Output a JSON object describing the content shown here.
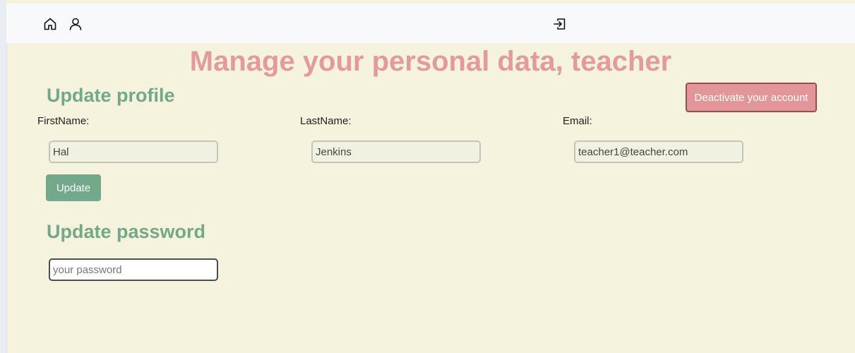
{
  "nav": {
    "icons": [
      "home-icon",
      "user-icon",
      "login-icon"
    ]
  },
  "page": {
    "title": "Manage your personal data, teacher"
  },
  "profile": {
    "heading": "Update profile",
    "deactivate_label": "Deactivate your account",
    "first_name_label": "FirstName:",
    "first_name_value": "Hal",
    "last_name_label": "LastName:",
    "last_name_value": "Jenkins",
    "email_label": "Email:",
    "email_value": "teacher1@teacher.com",
    "update_label": "Update"
  },
  "password": {
    "heading": "Update password",
    "placeholder": "your password"
  },
  "colors": {
    "background": "#f5f3dd",
    "navbar": "#f8f9fa",
    "title": "#e39a9a",
    "accent_green": "#73a88a",
    "danger": "#e3969a",
    "danger_border": "#9a4c4f"
  }
}
